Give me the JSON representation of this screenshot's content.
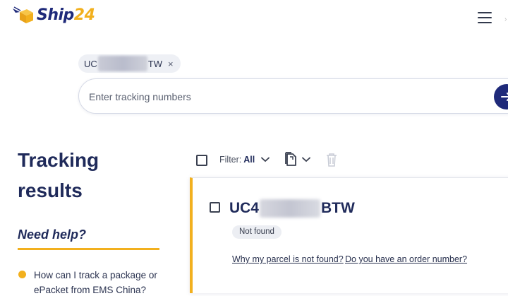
{
  "header": {
    "logo_text_main": "Ship",
    "logo_text_num": "24",
    "brand_colors": {
      "navy": "#1f2a7a",
      "accent": "#f2b01e"
    },
    "menu_icon": "hamburger-menu-icon"
  },
  "search": {
    "chip_prefix": "UC",
    "chip_suffix": "TW",
    "chip_close": "×",
    "placeholder": "Enter tracking numbers",
    "submit_icon": "arrow-right-icon"
  },
  "sidebar": {
    "title": "Tracking results",
    "need_help": "Need help?",
    "faq_item": "How can I track a package or ePacket from EMS China?"
  },
  "toolbar": {
    "filter_label": "Filter:",
    "filter_value": "All",
    "copy_icon": "copy-icon",
    "delete_icon": "trash-icon"
  },
  "result": {
    "tracking_prefix": "UC4",
    "tracking_suffix": "BTW",
    "status": "Not found",
    "link_not_found": "Why my parcel is not found?",
    "link_order_number": "Do you have an order number?"
  }
}
